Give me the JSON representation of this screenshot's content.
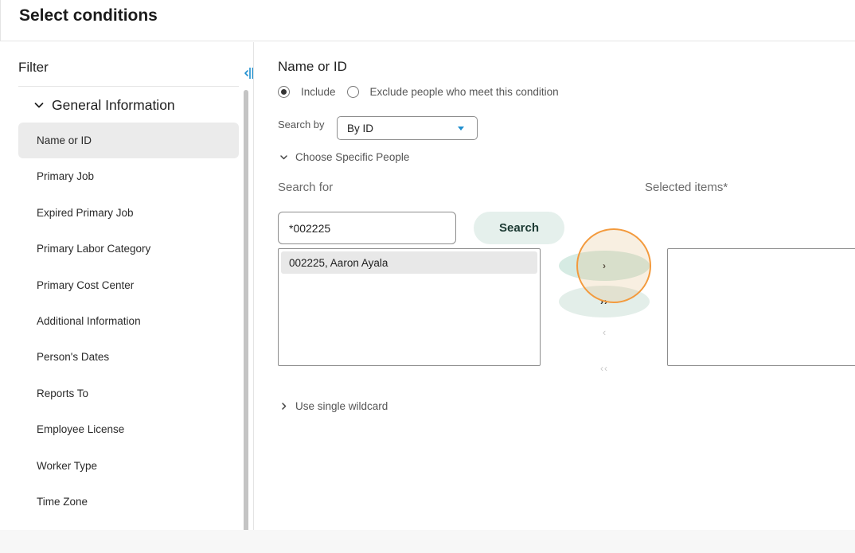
{
  "header": {
    "title": "Select conditions"
  },
  "sidebar": {
    "filter_title": "Filter",
    "group": {
      "label": "General Information"
    },
    "items": [
      {
        "label": "Name or ID",
        "active": true
      },
      {
        "label": "Primary Job"
      },
      {
        "label": "Expired Primary Job"
      },
      {
        "label": "Primary Labor Category"
      },
      {
        "label": "Primary Cost Center"
      },
      {
        "label": "Additional Information"
      },
      {
        "label": "Person's Dates"
      },
      {
        "label": "Reports To"
      },
      {
        "label": "Employee License"
      },
      {
        "label": "Worker Type"
      },
      {
        "label": "Time Zone"
      }
    ]
  },
  "condition": {
    "title": "Name or ID",
    "include_label": "Include",
    "exclude_label": "Exclude people who meet this condition",
    "selected_mode": "include",
    "search_by_label": "Search by",
    "search_by_value": "By ID",
    "choose_section_label": "Choose Specific People",
    "search_for_label": "Search for",
    "search_value": "*002225",
    "search_button": "Search",
    "results": [
      "002225, Aaron Ayala"
    ],
    "selected_items_label": "Selected items*",
    "selected_items": [],
    "move_one": "›",
    "move_all": "››",
    "remove_one": "‹",
    "remove_all": "‹‹",
    "wildcard_label": "Use single wildcard"
  },
  "colors": {
    "accent_button": "#e5f0ec",
    "highlight_ring": "#f39a3d",
    "dropdown_caret": "#1f8fcf"
  },
  "icons": {
    "collapse": "collapse-sidebar-icon",
    "group_chevron": "chevron-down-icon",
    "section_chevron_open": "chevron-down-icon",
    "section_chevron_closed": "chevron-right-icon",
    "dropdown": "caret-down-icon"
  }
}
